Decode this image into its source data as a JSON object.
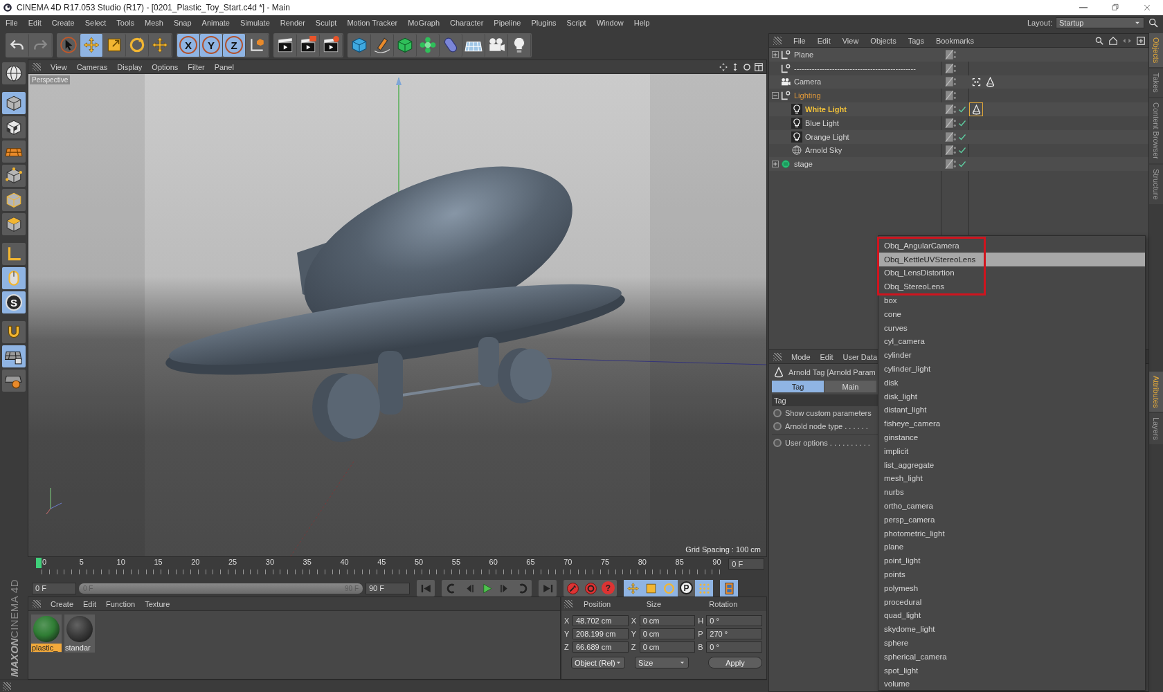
{
  "window": {
    "title": "CINEMA 4D R17.053 Studio (R17) - [0201_Plastic_Toy_Start.c4d *] - Main"
  },
  "menu_bar": [
    "File",
    "Edit",
    "Create",
    "Select",
    "Tools",
    "Mesh",
    "Snap",
    "Animate",
    "Simulate",
    "Render",
    "Sculpt",
    "Motion Tracker",
    "MoGraph",
    "Character",
    "Pipeline",
    "Plugins",
    "Script",
    "Window",
    "Help"
  ],
  "layout": {
    "label": "Layout:",
    "value": "Startup"
  },
  "toolbar": [
    {
      "kind": "undo",
      "selected": false,
      "disabled": false
    },
    {
      "kind": "redo",
      "selected": false,
      "disabled": true
    },
    {
      "kind": "select",
      "selected": false,
      "disabled": false
    },
    {
      "kind": "move",
      "selected": true,
      "disabled": false
    },
    {
      "kind": "scale",
      "selected": false,
      "disabled": false
    },
    {
      "kind": "rotate",
      "selected": false,
      "disabled": false
    },
    {
      "kind": "recent",
      "selected": false,
      "disabled": false
    },
    {
      "kind": "axis",
      "label": "X",
      "selected": true,
      "disabled": false
    },
    {
      "kind": "axis",
      "label": "Y",
      "selected": true,
      "disabled": false
    },
    {
      "kind": "axis",
      "label": "Z",
      "selected": true,
      "disabled": false
    },
    {
      "kind": "world",
      "selected": false,
      "disabled": false
    },
    {
      "kind": "render_view",
      "selected": false,
      "disabled": false
    },
    {
      "kind": "render_picture",
      "selected": false,
      "disabled": false
    },
    {
      "kind": "render_settings",
      "selected": false,
      "disabled": false
    },
    {
      "kind": "cube",
      "selected": false,
      "disabled": false
    },
    {
      "kind": "pen",
      "selected": false,
      "disabled": false
    },
    {
      "kind": "subdivision",
      "selected": false,
      "disabled": false
    },
    {
      "kind": "cloner",
      "selected": false,
      "disabled": false
    },
    {
      "kind": "deformer",
      "selected": false,
      "disabled": false
    },
    {
      "kind": "floor",
      "selected": false,
      "disabled": false
    },
    {
      "kind": "camera",
      "selected": false,
      "disabled": false
    },
    {
      "kind": "light",
      "selected": false,
      "disabled": false
    }
  ],
  "tool_palette": [
    {
      "kind": "sphere",
      "selected": false
    },
    {
      "kind": "model",
      "selected": true
    },
    {
      "kind": "texture",
      "selected": false
    },
    {
      "kind": "workplane",
      "selected": false
    },
    {
      "kind": "points",
      "selected": false
    },
    {
      "kind": "edges",
      "selected": false
    },
    {
      "kind": "polygons",
      "selected": false
    },
    {
      "kind": "axis_mode",
      "selected": false
    },
    {
      "kind": "tweak",
      "selected": true
    },
    {
      "kind": "solo",
      "label": "S",
      "selected": true
    },
    {
      "kind": "snap",
      "selected": false
    },
    {
      "kind": "lock_grid",
      "selected": true
    },
    {
      "kind": "planar",
      "selected": false
    }
  ],
  "logo": {
    "brand": "MAXON",
    "product": "CINEMA 4D"
  },
  "viewport": {
    "menu": [
      "View",
      "Cameras",
      "Display",
      "Options",
      "Filter",
      "Panel"
    ],
    "camera_label": "Perspective",
    "grid_spacing": "Grid Spacing : 100 cm"
  },
  "timeline": {
    "ticks": [
      "0",
      "5",
      "10",
      "15",
      "20",
      "25",
      "30",
      "35",
      "40",
      "45",
      "50",
      "55",
      "60",
      "65",
      "70",
      "75",
      "80",
      "85",
      "90"
    ],
    "current_frame": "0 F"
  },
  "playback": {
    "start": "0 F",
    "range_start": "0 F",
    "range_end": "90 F",
    "end": "90 F",
    "level": 1,
    "buttons": [
      {
        "kind": "go_start"
      },
      {
        "kind": "prev_key"
      },
      {
        "kind": "prev_frame"
      },
      {
        "kind": "play"
      },
      {
        "kind": "next_frame"
      },
      {
        "kind": "next_key"
      },
      {
        "kind": "go_end"
      },
      {
        "kind": "record"
      },
      {
        "kind": "autokey"
      },
      {
        "kind": "keyset",
        "label": "?"
      },
      {
        "kind": "key_position"
      },
      {
        "kind": "key_scale"
      },
      {
        "kind": "key_rotation"
      },
      {
        "kind": "key_parameter",
        "label": "P"
      },
      {
        "kind": "key_pla"
      },
      {
        "kind": "timeline"
      }
    ]
  },
  "materials": {
    "menu": [
      "Create",
      "Edit",
      "Function",
      "Texture"
    ],
    "items": [
      {
        "name": "plastic_",
        "selected": true,
        "color": "#2f7d34"
      },
      {
        "name": "standar",
        "selected": false,
        "color": "#3c3c3c"
      }
    ]
  },
  "coordinates": {
    "headers": [
      "Position",
      "Size",
      "Rotation"
    ],
    "rows": [
      [
        {
          "axis": "X",
          "value": "48.702 cm"
        },
        {
          "axis": "X",
          "value": "0 cm"
        },
        {
          "axis": "H",
          "value": "0 °"
        }
      ],
      [
        {
          "axis": "Y",
          "value": "208.199 cm"
        },
        {
          "axis": "Y",
          "value": "0 cm"
        },
        {
          "axis": "P",
          "value": "270 °"
        }
      ],
      [
        {
          "axis": "Z",
          "value": "66.689 cm"
        },
        {
          "axis": "Z",
          "value": "0 cm"
        },
        {
          "axis": "B",
          "value": "0 °"
        }
      ]
    ],
    "mode": "Object (Rel)",
    "size_mode": "Size",
    "apply": "Apply"
  },
  "objects": {
    "menu": [
      "File",
      "Edit",
      "View",
      "Objects",
      "Tags",
      "Bookmarks"
    ],
    "tree": [
      {
        "name": "Plane",
        "kind": "null",
        "expanded": false,
        "selected": false,
        "active": false
      },
      {
        "name": "------------------------------------------------",
        "kind": "null",
        "selected": false,
        "active": false
      },
      {
        "name": "Camera",
        "kind": "camera",
        "selected": false,
        "active": false,
        "tags": [
          {
            "kind": "compositing",
            "selected": false
          },
          {
            "kind": "arnold",
            "selected": false
          }
        ]
      },
      {
        "name": "Lighting",
        "kind": "null",
        "expanded": true,
        "selected": true,
        "active": false,
        "children": [
          {
            "name": "White Light",
            "kind": "light",
            "selected": true,
            "active": true,
            "checked": true,
            "tags": [
              {
                "kind": "arnold",
                "selected": true
              }
            ]
          },
          {
            "name": "Blue Light",
            "kind": "light",
            "selected": false,
            "active": false,
            "checked": true
          },
          {
            "name": "Orange Light",
            "kind": "light",
            "selected": false,
            "active": false,
            "checked": true
          },
          {
            "name": "Arnold Sky",
            "kind": "sky",
            "selected": false,
            "active": false,
            "checked": true
          }
        ]
      },
      {
        "name": "stage",
        "kind": "stage",
        "expanded": false,
        "selected": false,
        "active": false,
        "checked": true
      }
    ]
  },
  "attributes": {
    "menu": [
      "Mode",
      "Edit",
      "User Data"
    ],
    "title": "Arnold Tag [Arnold Param",
    "tabs": [
      {
        "label": "Tag",
        "selected": true
      },
      {
        "label": "Main",
        "selected": false
      }
    ],
    "section": "Tag",
    "params": [
      {
        "label": "Show custom parameters"
      },
      {
        "label": "Arnold node type . . . . . ."
      },
      {
        "label": "User options . . . . . . . . . ."
      }
    ]
  },
  "popup_menu": {
    "items": [
      {
        "label": "Obq_AngularCamera",
        "selected": false,
        "outlined": true
      },
      {
        "label": "Obq_KettleUVStereoLens",
        "selected": true,
        "outlined": true
      },
      {
        "label": "Obq_LensDistortion",
        "selected": false,
        "outlined": true
      },
      {
        "label": "Obq_StereoLens",
        "selected": false,
        "outlined": true
      },
      {
        "label": "box",
        "selected": false,
        "outlined": false
      },
      {
        "label": "cone",
        "selected": false,
        "outlined": false
      },
      {
        "label": "curves",
        "selected": false,
        "outlined": false
      },
      {
        "label": "cyl_camera",
        "selected": false,
        "outlined": false
      },
      {
        "label": "cylinder",
        "selected": false,
        "outlined": false
      },
      {
        "label": "cylinder_light",
        "selected": false,
        "outlined": false
      },
      {
        "label": "disk",
        "selected": false,
        "outlined": false
      },
      {
        "label": "disk_light",
        "selected": false,
        "outlined": false
      },
      {
        "label": "distant_light",
        "selected": false,
        "outlined": false
      },
      {
        "label": "fisheye_camera",
        "selected": false,
        "outlined": false
      },
      {
        "label": "ginstance",
        "selected": false,
        "outlined": false
      },
      {
        "label": "implicit",
        "selected": false,
        "outlined": false
      },
      {
        "label": "list_aggregate",
        "selected": false,
        "outlined": false
      },
      {
        "label": "mesh_light",
        "selected": false,
        "outlined": false
      },
      {
        "label": "nurbs",
        "selected": false,
        "outlined": false
      },
      {
        "label": "ortho_camera",
        "selected": false,
        "outlined": false
      },
      {
        "label": "persp_camera",
        "selected": false,
        "outlined": false
      },
      {
        "label": "photometric_light",
        "selected": false,
        "outlined": false
      },
      {
        "label": "plane",
        "selected": false,
        "outlined": false
      },
      {
        "label": "point_light",
        "selected": false,
        "outlined": false
      },
      {
        "label": "points",
        "selected": false,
        "outlined": false
      },
      {
        "label": "polymesh",
        "selected": false,
        "outlined": false
      },
      {
        "label": "procedural",
        "selected": false,
        "outlined": false
      },
      {
        "label": "quad_light",
        "selected": false,
        "outlined": false
      },
      {
        "label": "skydome_light",
        "selected": false,
        "outlined": false
      },
      {
        "label": "sphere",
        "selected": false,
        "outlined": false
      },
      {
        "label": "spherical_camera",
        "selected": false,
        "outlined": false
      },
      {
        "label": "spot_light",
        "selected": false,
        "outlined": false
      },
      {
        "label": "volume",
        "selected": false,
        "outlined": false
      }
    ]
  },
  "side_tabs": {
    "upper": [
      {
        "label": "Objects",
        "selected": true
      },
      {
        "label": "Takes",
        "selected": false
      },
      {
        "label": "Content Browser",
        "selected": false
      },
      {
        "label": "Structure",
        "selected": false
      }
    ],
    "lower": [
      {
        "label": "Attributes",
        "selected": true
      },
      {
        "label": "Layers",
        "selected": false
      }
    ]
  }
}
